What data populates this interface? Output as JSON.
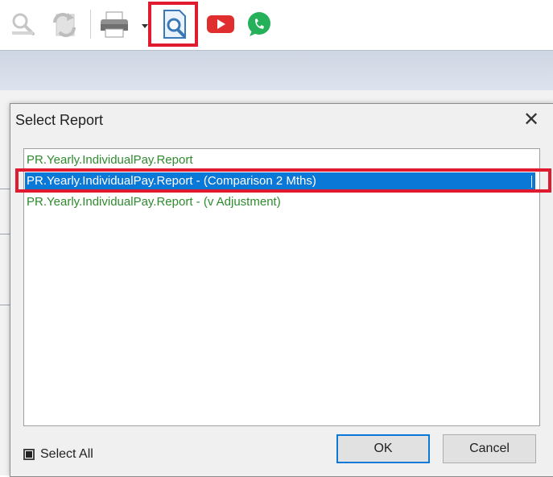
{
  "toolbar": {
    "icons": [
      "search-icon",
      "refresh-icon",
      "printer-icon",
      "print-preview-icon",
      "youtube-icon",
      "whatsapp-icon"
    ],
    "highlight_color": "#e01b2f",
    "youtube_color": "#e02d2d",
    "whatsapp_color": "#25b05a"
  },
  "dialog": {
    "title": "Select Report",
    "reports": [
      "PR.Yearly.IndividualPay.Report",
      "PR.Yearly.IndividualPay.Report - (Comparison 2 Mths)",
      "PR.Yearly.IndividualPay.Report - (v Adjustment)"
    ],
    "selected_index": 1,
    "select_all_label": "Select All",
    "ok_label": "OK",
    "cancel_label": "Cancel"
  },
  "colors": {
    "item_text": "#2e8b2e",
    "selection": "#0a78d7",
    "annotation": "#e01b2f"
  }
}
